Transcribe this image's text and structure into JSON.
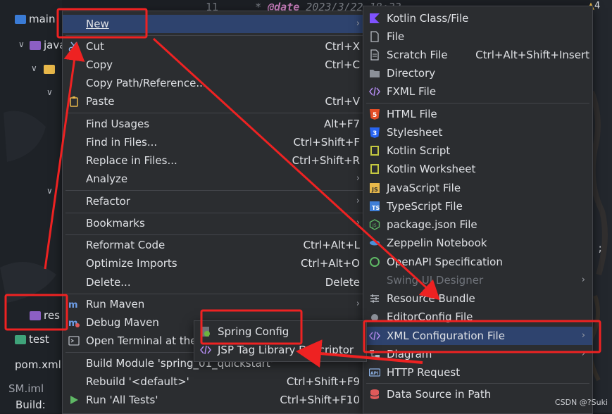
{
  "code_line": {
    "line_number": "11",
    "prefix": "* ",
    "tag": "@date",
    "value": " 2023/3/22 18:33"
  },
  "notifications": {
    "count": "4"
  },
  "tree": {
    "main": "main",
    "java": "java",
    "res": "res",
    "test": "test",
    "pom": "pom.xml",
    "iml": "SM.iml",
    "build_label": "Build:"
  },
  "context_menu": {
    "items": [
      {
        "label": "New",
        "shortcut": "",
        "submenu": true,
        "icon": ""
      },
      {
        "label": "Cut",
        "shortcut": "Ctrl+X",
        "icon": "scissors-icon"
      },
      {
        "label": "Copy",
        "shortcut": "Ctrl+C",
        "icon": ""
      },
      {
        "label": "Copy Path/Reference...",
        "shortcut": "",
        "icon": ""
      },
      {
        "label": "Paste",
        "shortcut": "Ctrl+V",
        "icon": "clipboard-icon"
      },
      {
        "label": "Find Usages",
        "shortcut": "Alt+F7",
        "icon": ""
      },
      {
        "label": "Find in Files...",
        "shortcut": "Ctrl+Shift+F",
        "icon": ""
      },
      {
        "label": "Replace in Files...",
        "shortcut": "Ctrl+Shift+R",
        "icon": ""
      },
      {
        "label": "Analyze",
        "shortcut": "",
        "submenu": true,
        "icon": ""
      },
      {
        "label": "Refactor",
        "shortcut": "",
        "submenu": true,
        "icon": ""
      },
      {
        "label": "Bookmarks",
        "shortcut": "",
        "submenu": true,
        "icon": ""
      },
      {
        "label": "Reformat Code",
        "shortcut": "Ctrl+Alt+L",
        "icon": ""
      },
      {
        "label": "Optimize Imports",
        "shortcut": "Ctrl+Alt+O",
        "icon": ""
      },
      {
        "label": "Delete...",
        "shortcut": "Delete",
        "icon": ""
      },
      {
        "label": "Run Maven",
        "shortcut": "",
        "submenu": true,
        "icon": "maven-icon"
      },
      {
        "label": "Debug Maven",
        "shortcut": "",
        "submenu": true,
        "icon": "maven-debug-icon"
      },
      {
        "label": "Open Terminal at the",
        "shortcut": "",
        "icon": "terminal-icon"
      },
      {
        "label": "Build Module 'spring_01_quickstart'",
        "shortcut": "",
        "icon": ""
      },
      {
        "label": "Rebuild '<default>'",
        "shortcut": "Ctrl+Shift+F9",
        "icon": ""
      },
      {
        "label": "Run 'All Tests'",
        "shortcut": "Ctrl+Shift+F10",
        "icon": "run-icon"
      }
    ]
  },
  "new_submenu": {
    "items": [
      {
        "label": "Kotlin Class/File",
        "icon": "kotlin-icon"
      },
      {
        "label": "File",
        "icon": "file-icon"
      },
      {
        "label": "Scratch File",
        "shortcut": "Ctrl+Alt+Shift+Insert",
        "icon": "scratch-file-icon"
      },
      {
        "label": "Directory",
        "icon": "folder-icon"
      },
      {
        "label": "FXML File",
        "icon": "fxml-icon"
      },
      {
        "label": "HTML File",
        "icon": "html5-icon"
      },
      {
        "label": "Stylesheet",
        "icon": "css3-icon"
      },
      {
        "label": "Kotlin Script",
        "icon": "kotlin-script-icon"
      },
      {
        "label": "Kotlin Worksheet",
        "icon": "kotlin-worksheet-icon"
      },
      {
        "label": "JavaScript File",
        "icon": "javascript-icon"
      },
      {
        "label": "TypeScript File",
        "icon": "typescript-icon"
      },
      {
        "label": "package.json File",
        "icon": "nodejs-icon"
      },
      {
        "label": "Zeppelin Notebook",
        "icon": "zeppelin-icon"
      },
      {
        "label": "OpenAPI Specification",
        "icon": "openapi-icon"
      },
      {
        "label": "Swing UI Designer",
        "submenu": true,
        "disabled": true,
        "icon": ""
      },
      {
        "label": "Resource Bundle",
        "icon": "resource-bundle-icon"
      },
      {
        "label": "EditorConfig File",
        "icon": "editorconfig-icon"
      },
      {
        "label": "XML Configuration File",
        "submenu": true,
        "icon": "xml-icon"
      },
      {
        "label": "Diagram",
        "submenu": true,
        "icon": "diagram-icon"
      },
      {
        "label": "HTTP Request",
        "icon": "api-icon"
      },
      {
        "label": "Data Source in Path",
        "icon": "database-icon"
      }
    ]
  },
  "xml_submenu": {
    "items": [
      {
        "label": "Spring Config",
        "icon": "spring-icon"
      },
      {
        "label": "JSP Tag Library Descriptor",
        "icon": "xml-tag-icon"
      }
    ]
  },
  "watermark": "CSDN @?Suki",
  "colors": {
    "menu_bg": "#2b2d30",
    "selection": "#2e436e",
    "annotation_red": "#ee2222",
    "kotlin": "#7f52ff",
    "html5": "#e44d26",
    "css3": "#2965f1",
    "spring": "#6db33f"
  }
}
